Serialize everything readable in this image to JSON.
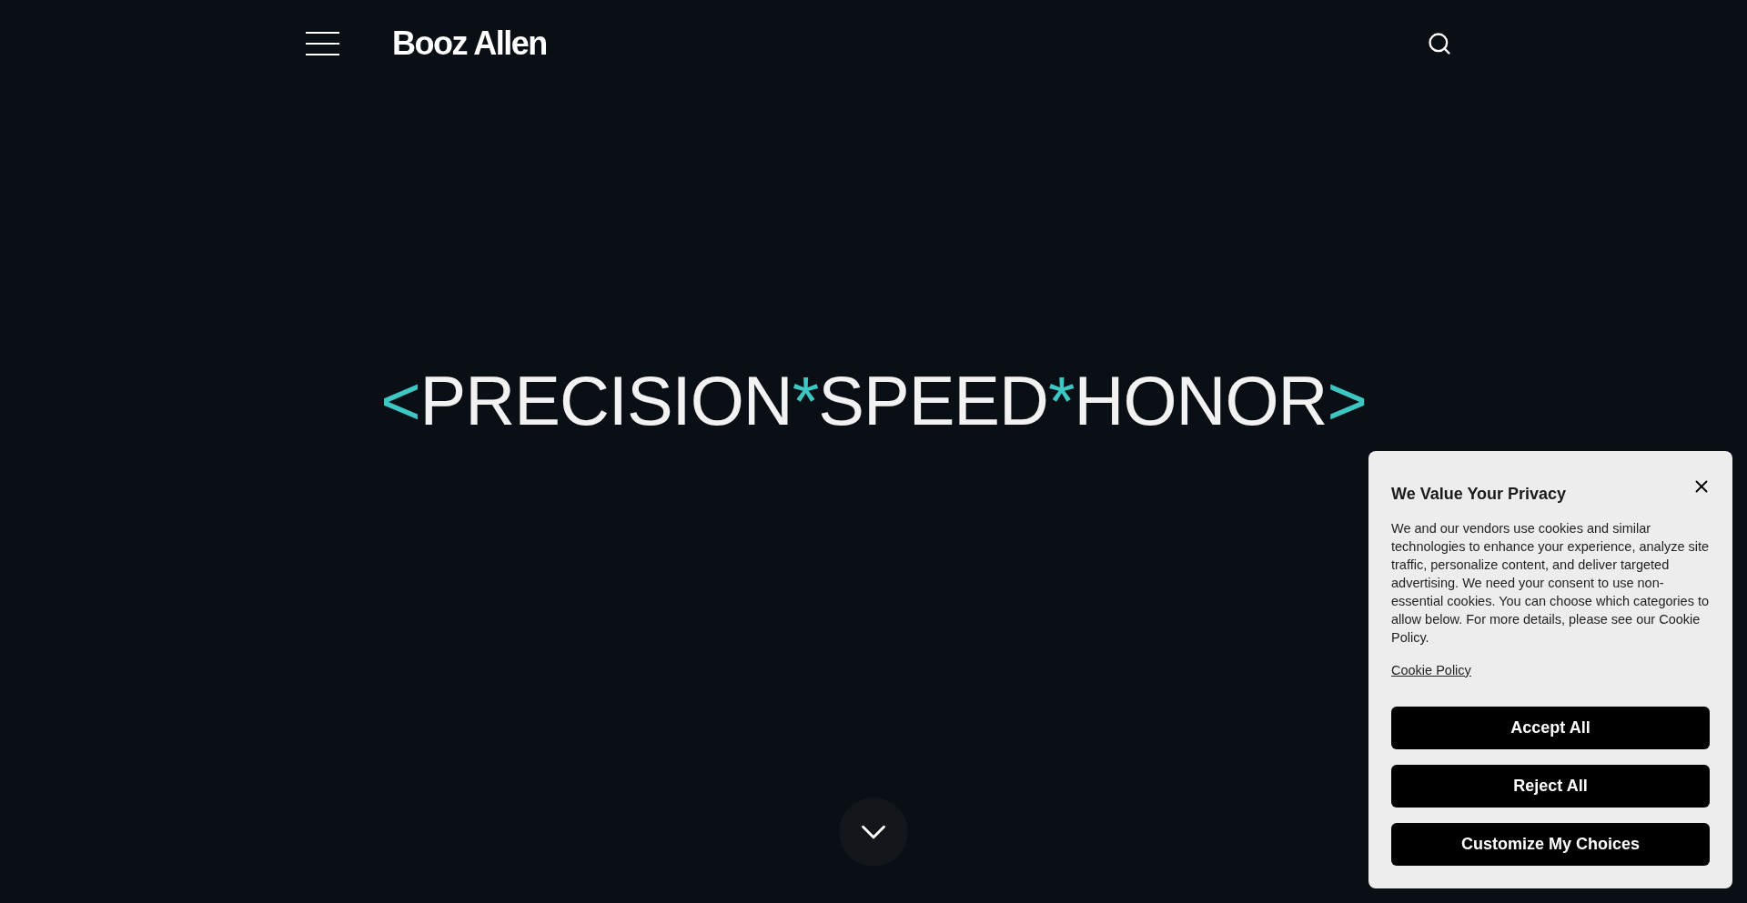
{
  "header": {
    "logo": "Booz Allen"
  },
  "hero": {
    "segments": [
      {
        "text": "<",
        "kind": "accent"
      },
      {
        "text": "PRECISION",
        "kind": "word"
      },
      {
        "text": "*",
        "kind": "accent"
      },
      {
        "text": "SPEED",
        "kind": "word"
      },
      {
        "text": "*",
        "kind": "accent"
      },
      {
        "text": "HONOR",
        "kind": "word"
      },
      {
        "text": ">",
        "kind": "accent"
      }
    ]
  },
  "cookie_banner": {
    "title": "We Value Your Privacy",
    "body": "We and our vendors use cookies and similar technologies to enhance your experience, analyze site traffic, personalize content, and deliver targeted advertising. We need your consent to use non-essential cookies. You can choose which categories to allow below. For more details, please see our Cookie Policy.",
    "link": "Cookie Policy",
    "buttons": [
      "Accept All",
      "Reject All",
      "Customize My Choices"
    ]
  }
}
